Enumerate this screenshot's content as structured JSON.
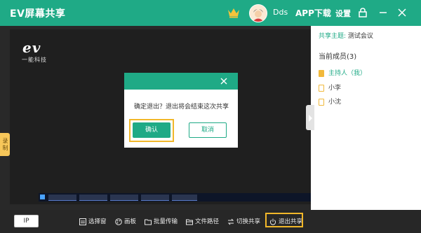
{
  "titlebar": {
    "app_title": "EV屏幕共享",
    "user_name": "Dds",
    "app_download": "APP下载",
    "settings": "设置",
    "icons": [
      "crown-icon",
      "avatar",
      "lock-icon",
      "minimize-icon",
      "close-icon"
    ]
  },
  "shared_screen": {
    "logo_text": "ev",
    "logo_subtitle": "一能科技",
    "record_tab": "录制"
  },
  "panel": {
    "topic_label": "共享主题:",
    "topic_value": "测试会议",
    "members_title": "当前成员(3)",
    "members": [
      {
        "name": "主持人（我）",
        "host": true
      },
      {
        "name": "小李",
        "host": false
      },
      {
        "name": "小沈",
        "host": false
      }
    ]
  },
  "dialog": {
    "message": "确定退出？退出将会结束这次共享",
    "confirm": "确认",
    "cancel": "取消"
  },
  "bottombar": {
    "ip": "IP",
    "tools": {
      "select": "选择窗",
      "whiteboard": "画板",
      "batch": "批量传输",
      "path": "文件路径",
      "switch": "切换共享",
      "exit": "退出共享"
    }
  },
  "colors": {
    "brand": "#1faa86",
    "highlight": "#f1b72a",
    "host": "#f1b93b"
  }
}
